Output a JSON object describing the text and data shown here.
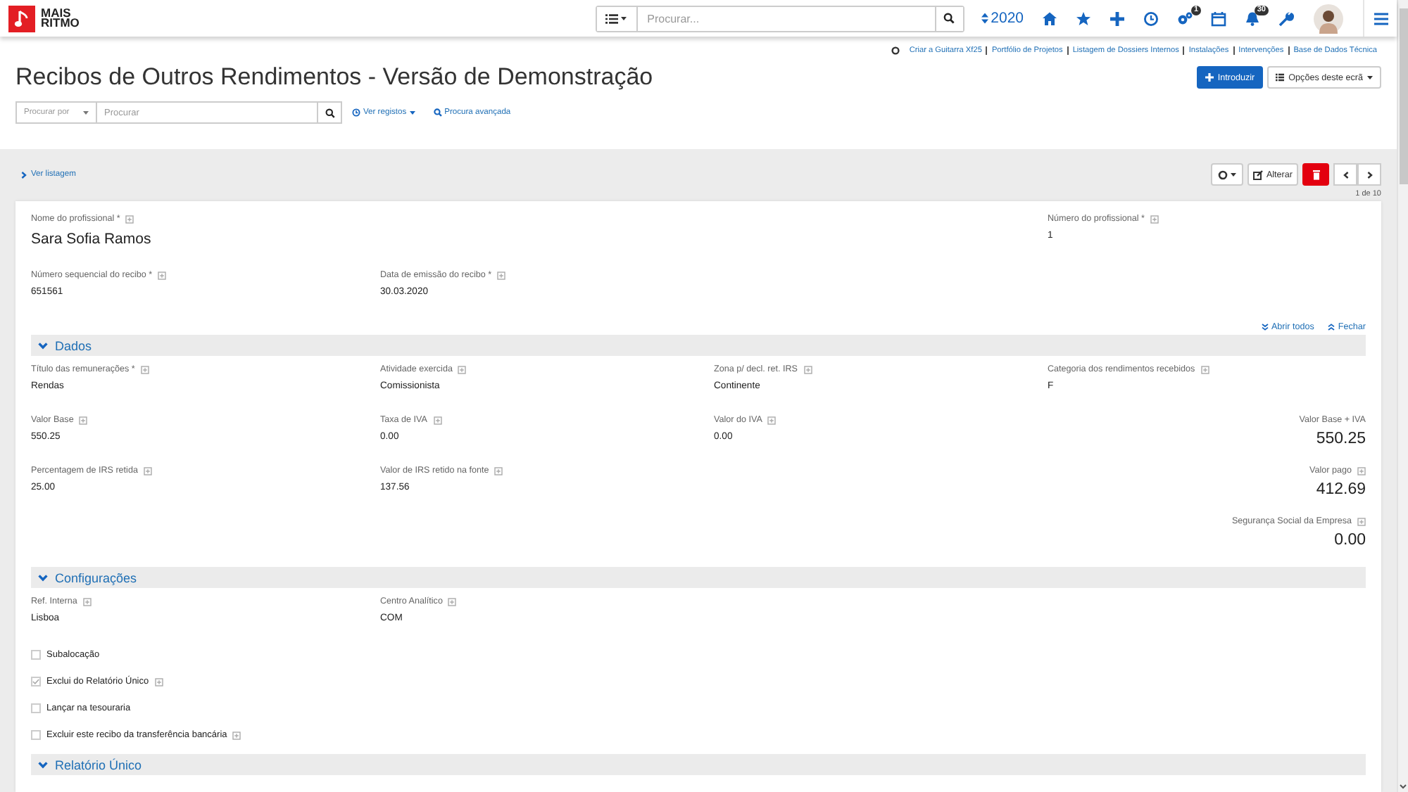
{
  "brand": {
    "line_1": "MAIS",
    "line_2": "RITMO"
  },
  "top_search": {
    "placeholder": "Procurar..."
  },
  "year": "2020",
  "badges": [
    {
      "text": "1"
    },
    {
      "text": "30"
    }
  ],
  "shortcuts": [
    "Criar a Guitarra Xf25",
    "Portfólio de Projetos",
    "Listagem de Dossiers Internos",
    "Instalações",
    "Intervenções",
    "Base de Dados Técnica"
  ],
  "title": "Recibos de Outros Rendimentos - Versão de Demonstração",
  "header_buttons": [
    {
      "label": "Introduzir",
      "kind": "primary"
    },
    {
      "label": "Opções deste ecrã",
      "kind": "options"
    }
  ],
  "search": {
    "filter_placeholder": "Procurar por",
    "placeholder": "Procurar",
    "links": [
      {
        "label": "Ver registos",
        "kind": "records"
      },
      {
        "label": "Procura avançada",
        "kind": "advanced"
      }
    ]
  },
  "back_link": "Ver listagem",
  "record_toolbar": {
    "edit": "Alterar",
    "counter": "1 de 10"
  },
  "top_rows": [
    [
      {
        "label": "Nome do profissional *",
        "value": "Sara Sofia Ramos",
        "kind": "name",
        "info": true
      },
      {
        "label": "Número do profissional *",
        "value": "1",
        "kind": "text",
        "info": true
      }
    ],
    [
      {
        "label": "Número sequencial do recibo *",
        "value": "651561",
        "kind": "text",
        "info": true
      },
      {
        "label": "Data de emissão do recibo *",
        "value": "30.03.2020",
        "kind": "text",
        "info": true
      }
    ]
  ],
  "expand_links": {
    "open_all": "Abrir todos",
    "close": "Fechar"
  },
  "sections": [
    {
      "title": "Dados",
      "expanded": true,
      "rows": [
        [
          {
            "label": "Título das remunerações *",
            "value": "Rendas",
            "kind": "text",
            "info": true
          },
          {
            "label": "Atividade exercida",
            "value": "Comissionista",
            "kind": "text",
            "info": true
          },
          {
            "label": "Zona p/ decl. ret. IRS",
            "value": "Continente",
            "kind": "text",
            "info": true
          },
          {
            "label": "Categoria dos rendimentos recebidos",
            "value": "F",
            "kind": "text",
            "info": true
          }
        ],
        [
          {
            "label": "Valor Base",
            "value": "550.25",
            "kind": "text",
            "info": true
          },
          {
            "label": "Taxa de IVA",
            "value": "0.00",
            "kind": "text",
            "info": true
          },
          {
            "label": "Valor do IVA",
            "value": "0.00",
            "kind": "text",
            "info": true
          },
          {
            "label": "Valor Base + IVA",
            "value": "550.25",
            "kind": "total",
            "info": false
          }
        ],
        [
          {
            "label": "Percentagem de IRS retida",
            "value": "25.00",
            "kind": "text",
            "info": true
          },
          {
            "label": "Valor de IRS retido na fonte",
            "value": "137.56",
            "kind": "text",
            "info": true
          },
          {
            "label": "Valor pago",
            "value": "412.69",
            "kind": "total",
            "info": true
          }
        ],
        [
          {
            "label": "Segurança Social da Empresa",
            "value": "0.00",
            "kind": "total",
            "info": true
          }
        ]
      ]
    },
    {
      "title": "Configurações",
      "expanded": true,
      "rows": [
        [
          {
            "label": "Ref. Interna",
            "value": "Lisboa",
            "kind": "text",
            "info": true
          },
          {
            "label": "Centro Analítico",
            "value": "COM",
            "kind": "text",
            "info": true
          }
        ]
      ],
      "checkboxes": [
        {
          "label": "Subalocação",
          "checked": false,
          "info": false
        },
        {
          "label": "Exclui do Relatório Único",
          "checked": true,
          "info": true
        },
        {
          "label": "Lançar na tesouraria",
          "checked": false,
          "info": false
        },
        {
          "label": "Excluir este recibo da transferência bancária",
          "checked": false,
          "info": true
        }
      ]
    },
    {
      "title": "Relatório Único",
      "expanded": true
    }
  ]
}
